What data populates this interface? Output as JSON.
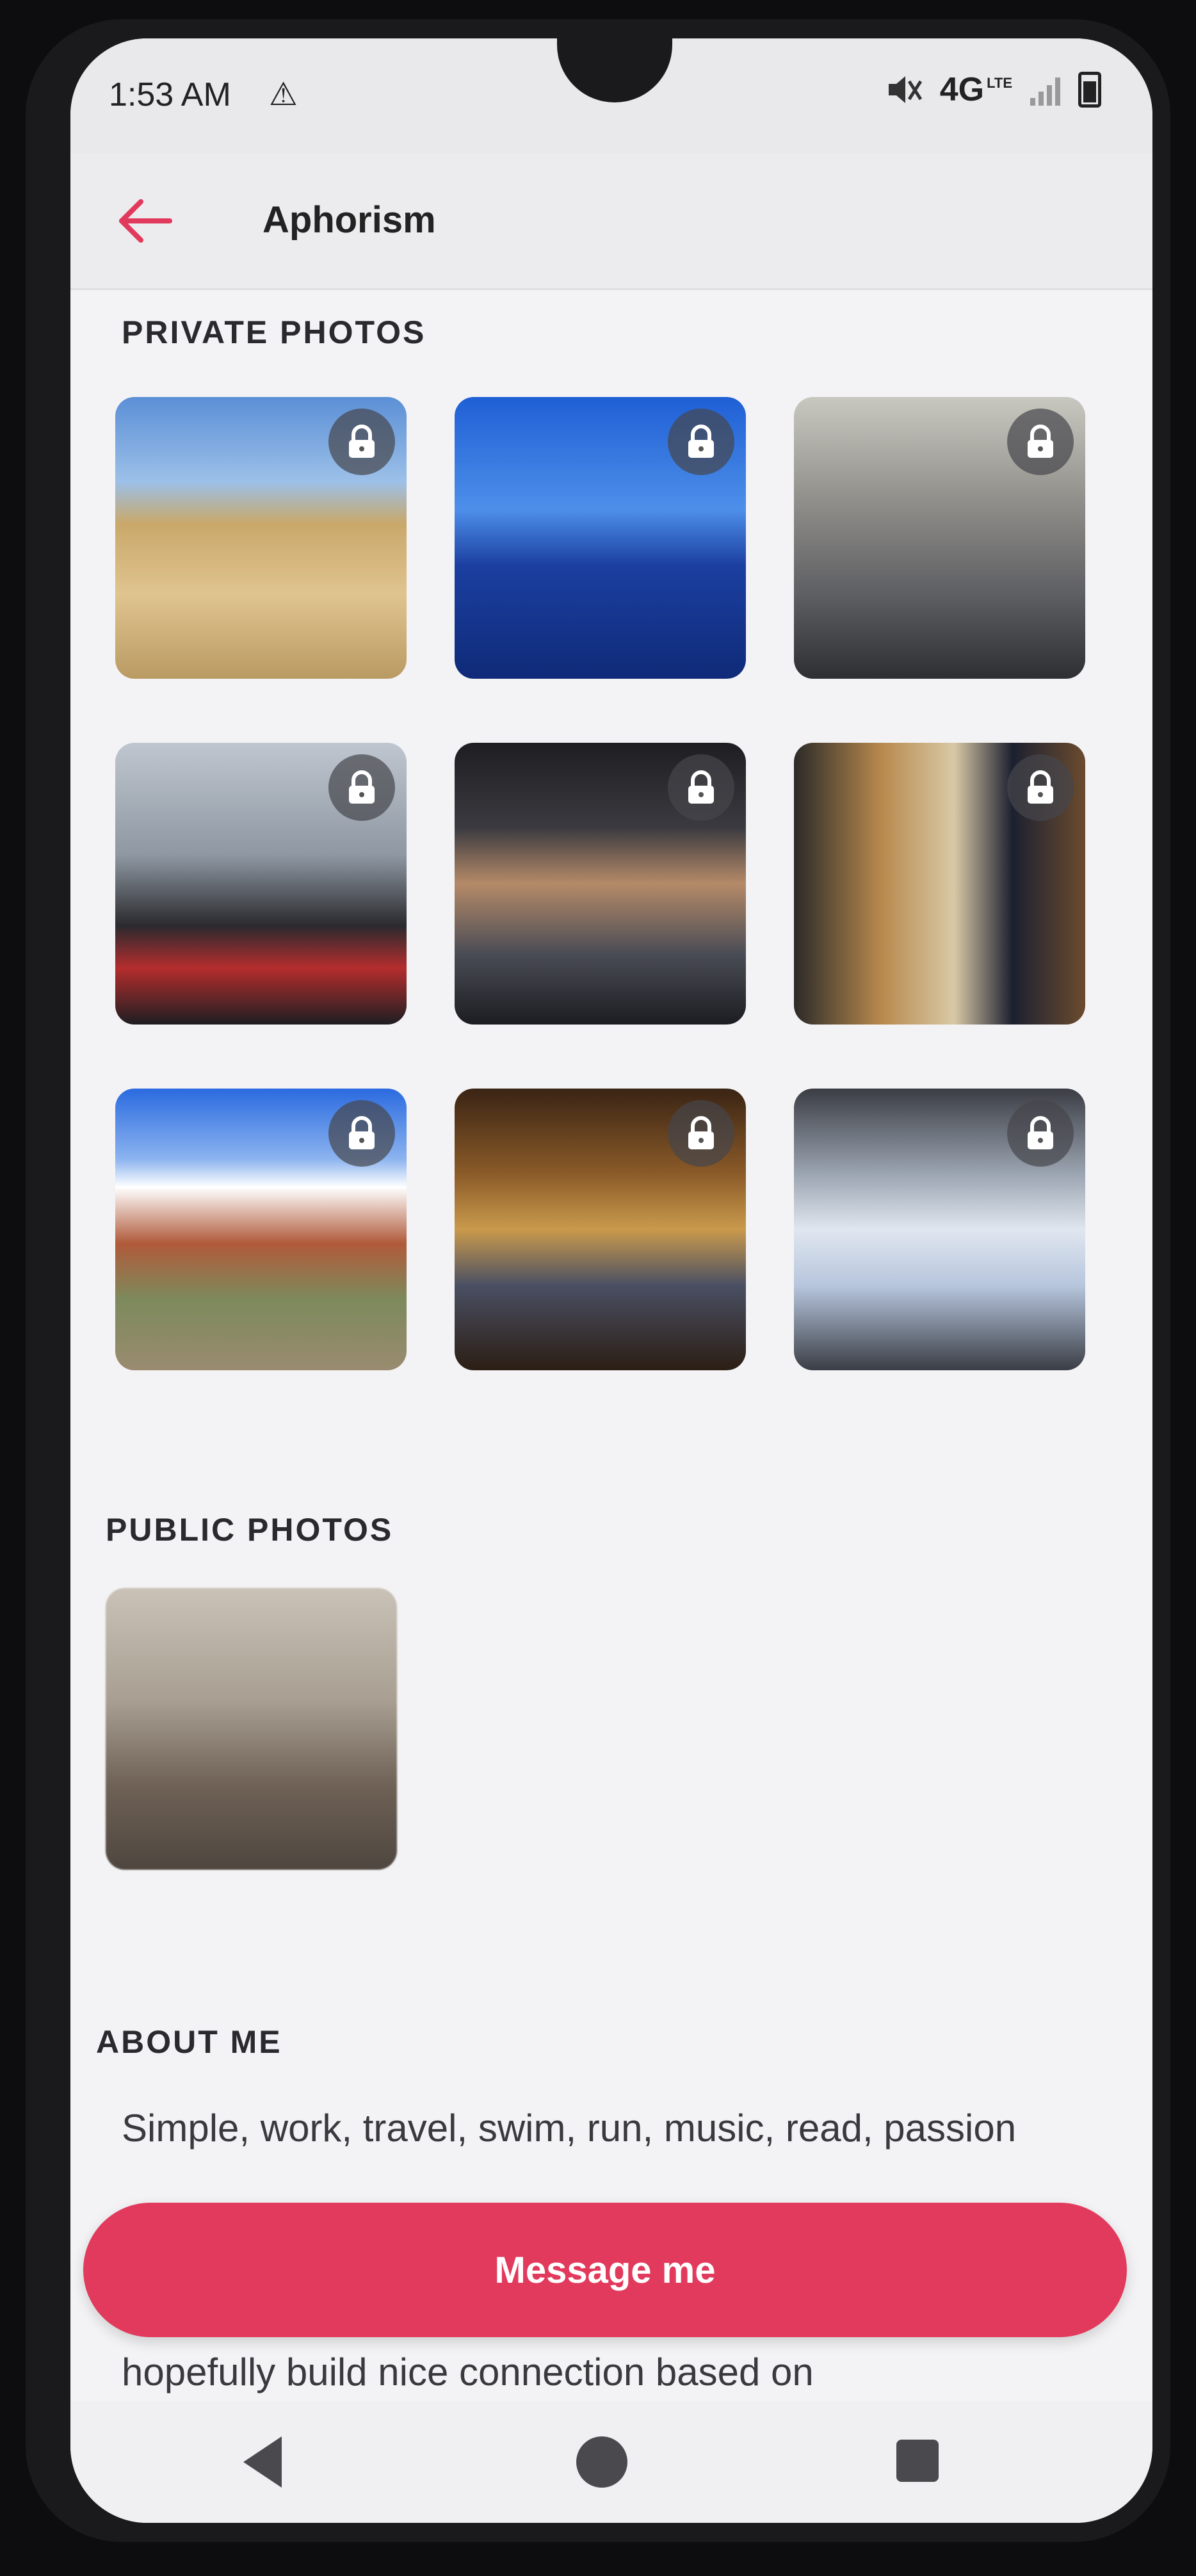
{
  "status_bar": {
    "time": "1:53 AM",
    "warning_icon": "warning-triangle-icon",
    "network": "4G",
    "lte": "LTE",
    "mute_icon": "mute-icon"
  },
  "app_bar": {
    "title": "Aphorism",
    "back_icon": "back-arrow-icon"
  },
  "private_photos": {
    "title": "PRIVATE PHOTOS",
    "photos": [
      {
        "name": "pyramids",
        "bg": "linear-gradient(180deg,#5b8fd6 0%,#9cc0e8 30%,#c9a86a 45%,#e0c48f 70%,#b99a63 100%)",
        "locked": true
      },
      {
        "name": "boat",
        "bg": "linear-gradient(180deg,#1f5fd6 0%,#4d8fe9 40%,#1b3fa0 60%,#0f2a78 100%)",
        "locked": true
      },
      {
        "name": "selfie-glasses",
        "bg": "linear-gradient(180deg,#c8c8c0 0%,#8c8a86 40%,#5e5f63 70%,#2e2f33 100%)",
        "locked": true
      },
      {
        "name": "ferrari-jacket",
        "bg": "linear-gradient(180deg,#bfc6cf 0%,#8e97a2 40%,#2a2a2e 65%,#b42d2d 80%,#1e1e22 100%)",
        "locked": true
      },
      {
        "name": "car-selfie",
        "bg": "linear-gradient(180deg,#1e1e22 0%,#3a3a40 30%,#b58a68 50%,#4a4c55 75%,#1c1d22 100%)",
        "locked": true
      },
      {
        "name": "suit-mirror",
        "bg": "linear-gradient(90deg,#2b2a28 0%,#b8894d 30%,#d8c9a6 55%,#1c2030 75%,#6b4b2f 100%)",
        "locked": true
      },
      {
        "name": "red-rocks",
        "bg": "linear-gradient(180deg,#2b6be0 0%,#8bb3ef 25%,#ffffff 35%,#b05a3a 55%,#7d8a5c 75%,#9a8b70 100%)",
        "locked": true
      },
      {
        "name": "bar-stool",
        "bg": "linear-gradient(180deg,#3a2414 0%,#8a5a28 30%,#c99a4c 50%,#4a4f63 70%,#2b1e14 100%)",
        "locked": true
      },
      {
        "name": "car-driver",
        "bg": "linear-gradient(180deg,#3b3d44 0%,#9aa3b0 30%,#dfe6ef 50%,#b7c6dd 70%,#3a3d45 100%)",
        "locked": true
      }
    ]
  },
  "public_photos": {
    "title": "PUBLIC PHOTOS",
    "photos": [
      {
        "name": "blurred-photo",
        "bg": "linear-gradient(180deg,#c9c2b6 0%,#a89f92 40%,#6f6256 70%,#4e463f 100%)"
      }
    ]
  },
  "about": {
    "title": "ABOUT ME",
    "text": "Simple, work, travel, swim, run, music, read, passion",
    "text_continued": "hopefully build nice connection based on"
  },
  "actions": {
    "message_label": "Message me"
  },
  "colors": {
    "accent": "#e23a5c"
  }
}
